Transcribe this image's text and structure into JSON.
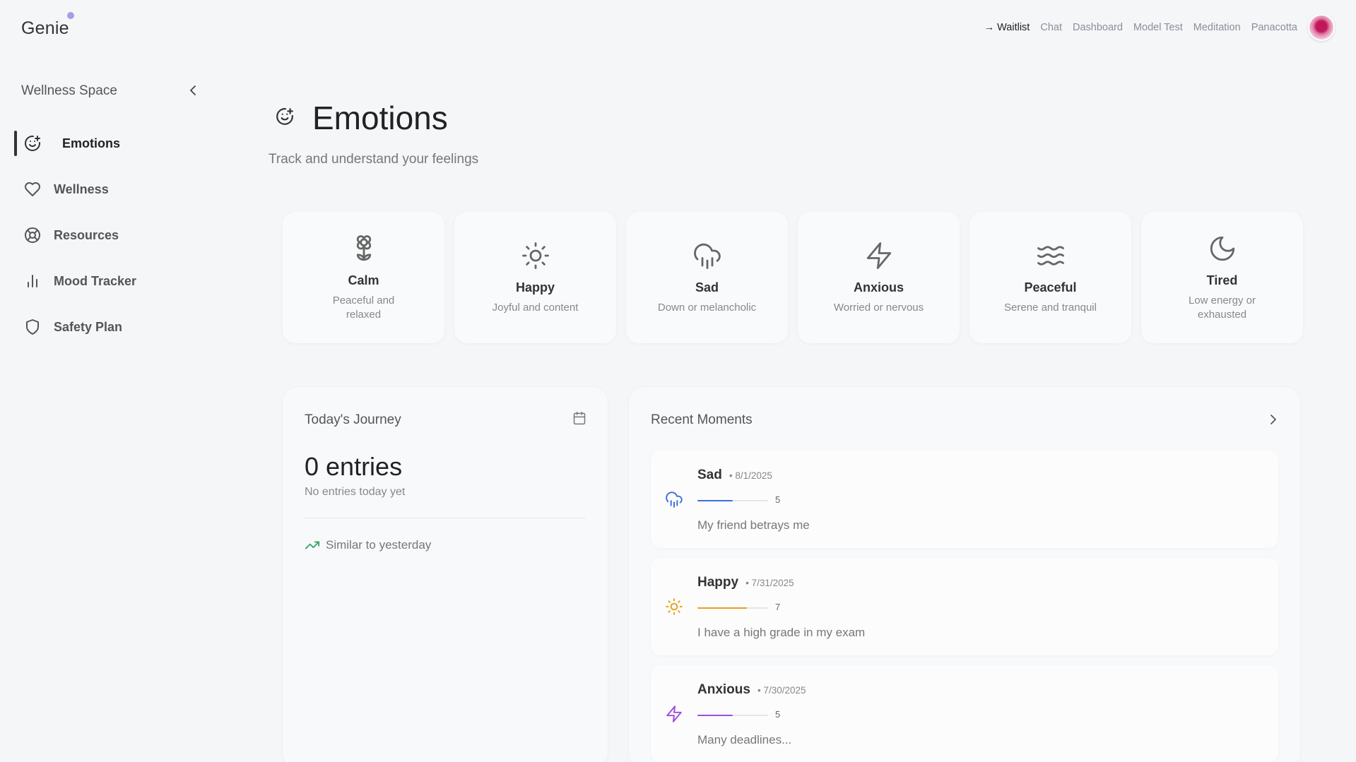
{
  "app": {
    "logo": "Genie"
  },
  "topnav": {
    "waitlist": "→ Waitlist",
    "links": [
      "Chat",
      "Dashboard",
      "Model Test",
      "Meditation",
      "Panacotta"
    ]
  },
  "sidebar": {
    "title": "Wellness Space",
    "items": [
      {
        "label": "Emotions",
        "icon": "smile-plus-icon"
      },
      {
        "label": "Wellness",
        "icon": "heart-icon"
      },
      {
        "label": "Resources",
        "icon": "lifebuoy-icon"
      },
      {
        "label": "Mood Tracker",
        "icon": "bar-chart-icon"
      },
      {
        "label": "Safety Plan",
        "icon": "shield-icon"
      }
    ]
  },
  "header": {
    "title": "Emotions",
    "subtitle": "Track and understand your feelings"
  },
  "emotions": [
    {
      "label": "Calm",
      "desc": "Peaceful and relaxed",
      "icon": "flower-icon"
    },
    {
      "label": "Happy",
      "desc": "Joyful and content",
      "icon": "sun-icon"
    },
    {
      "label": "Sad",
      "desc": "Down or melancholic",
      "icon": "cloud-rain-icon"
    },
    {
      "label": "Anxious",
      "desc": "Worried or nervous",
      "icon": "zap-icon"
    },
    {
      "label": "Peaceful",
      "desc": "Serene and tranquil",
      "icon": "waves-icon"
    },
    {
      "label": "Tired",
      "desc": "Low energy or exhausted",
      "icon": "moon-icon"
    }
  ],
  "journey": {
    "title": "Today's Journey",
    "entries": "0 entries",
    "subtitle": "No entries today yet",
    "trend": "Similar to yesterday"
  },
  "recent": {
    "title": "Recent Moments",
    "moments": [
      {
        "name": "Sad",
        "date": "• 8/1/2025",
        "intensity": 5,
        "max": 10,
        "note": "My friend betrays me",
        "color": "#3b6fd8",
        "icon": "cloud-rain-icon"
      },
      {
        "name": "Happy",
        "date": "• 7/31/2025",
        "intensity": 7,
        "max": 10,
        "note": "I have a high grade in my exam",
        "color": "#e6a020",
        "icon": "sun-icon"
      },
      {
        "name": "Anxious",
        "date": "• 7/30/2025",
        "intensity": 5,
        "max": 10,
        "note": "Many deadlines...",
        "color": "#9b4fd8",
        "icon": "zap-icon"
      }
    ]
  },
  "colors": {
    "accent_dot": "#a99ce6",
    "trend_green": "#3aa36a"
  }
}
